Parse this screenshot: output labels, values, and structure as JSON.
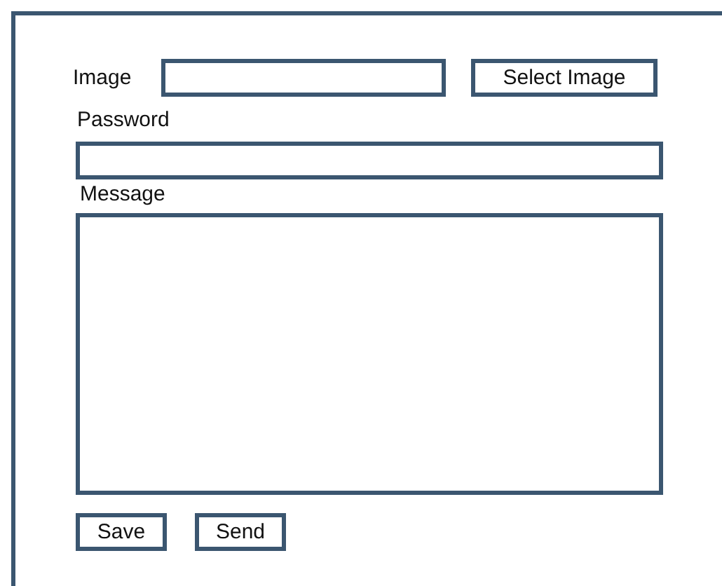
{
  "image_field": {
    "label": "Image",
    "button": "Select Image"
  },
  "password_field": {
    "label": "Password"
  },
  "message_field": {
    "label": "Message"
  },
  "buttons": [
    {
      "label": "Save"
    },
    {
      "label": "Send"
    }
  ]
}
